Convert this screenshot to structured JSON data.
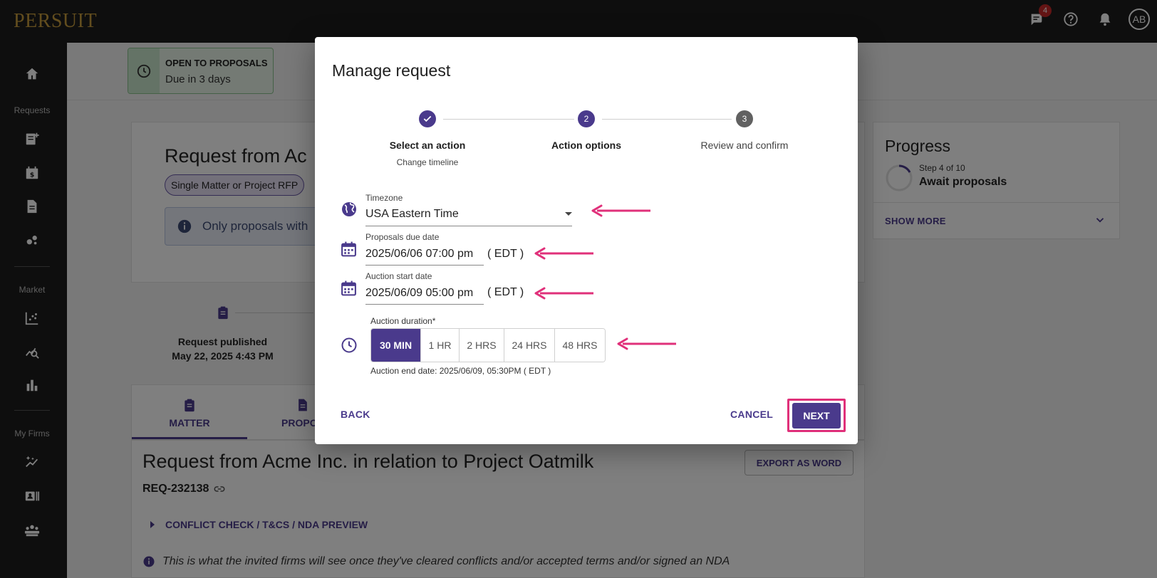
{
  "app": {
    "logo": "PERSUIT"
  },
  "topbar": {
    "messages_badge": "4",
    "avatar_initials": "AB"
  },
  "sidebar": {
    "section_requests": "Requests",
    "section_market": "Market",
    "section_my_firms": "My Firms"
  },
  "status": {
    "title": "OPEN TO PROPOSALS",
    "subtitle": "Due in 3 days"
  },
  "request_card": {
    "title": "Request from Ac",
    "chip": "Single Matter or Project RFP",
    "banner_text": "Only proposals with"
  },
  "timeline": {
    "published_label": "Request published",
    "published_date": "May 22, 2025 4:43 PM"
  },
  "tabs": {
    "matter": "MATTER",
    "proposals": "PROPOS"
  },
  "content": {
    "title": "Request from Acme Inc. in relation to Project Oatmilk",
    "req_id": "REQ-232138",
    "export_label": "EXPORT AS WORD",
    "conflict_label": "CONFLICT CHECK / T&CS / NDA PREVIEW",
    "info_text": "This is what the invited firms will see once they've cleared conflicts and/or accepted terms and/or signed an NDA"
  },
  "progress": {
    "title": "Progress",
    "step": "Step 4 of 10",
    "name": "Await proposals",
    "show_more": "SHOW MORE"
  },
  "modal": {
    "title": "Manage request",
    "steps": [
      {
        "number": "1",
        "label": "Select an action",
        "sub": "Change timeline"
      },
      {
        "number": "2",
        "label": "Action options",
        "sub": ""
      },
      {
        "number": "3",
        "label": "Review and confirm",
        "sub": ""
      }
    ],
    "timezone": {
      "label": "Timezone",
      "value": "USA Eastern Time"
    },
    "due_date": {
      "label": "Proposals due date",
      "value": "2025/06/06 07:00 pm",
      "tz": "( EDT )"
    },
    "auction_start": {
      "label": "Auction start date",
      "value": "2025/06/09 05:00 pm",
      "tz": "( EDT )"
    },
    "duration": {
      "label": "Auction duration*",
      "options": [
        "30 MIN",
        "1 HR",
        "2 HRS",
        "24 HRS",
        "48 HRS"
      ],
      "selected": "30 MIN",
      "end_text": "Auction end date: 2025/06/09, 05:30PM ( EDT )"
    },
    "back_label": "BACK",
    "cancel_label": "CANCEL",
    "next_label": "NEXT"
  },
  "colors": {
    "primary": "#4a3a8c",
    "annotation": "#e0307a",
    "dark": "#1d1d1d"
  }
}
